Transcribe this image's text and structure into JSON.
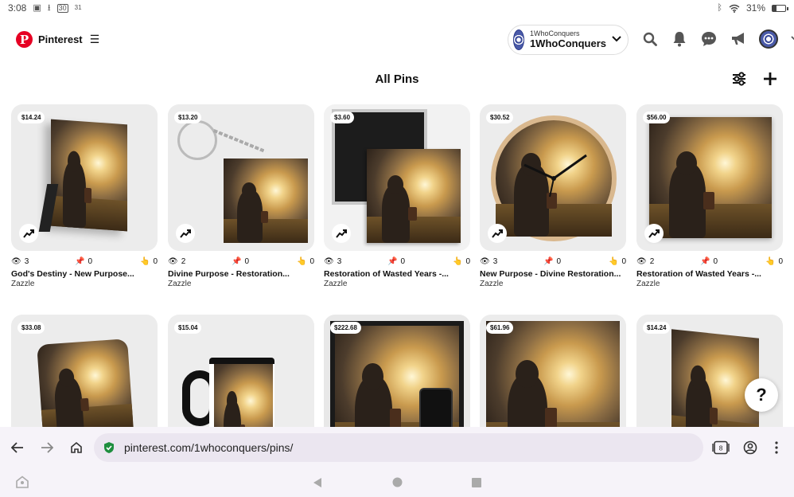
{
  "status_bar": {
    "time": "3:08",
    "notif_date": "30",
    "notif_extra": "31",
    "battery_text": "31%",
    "battery_level": 0.31
  },
  "header": {
    "brand": "Pinterest",
    "account_small": "1WhoConquers",
    "account_big": "1WhoConquers",
    "icons": [
      "search-icon",
      "bell-icon",
      "messages-icon",
      "megaphone-icon",
      "avatar",
      "chevron-down-icon"
    ]
  },
  "page": {
    "title": "All Pins"
  },
  "pins": [
    {
      "price": "$14.24",
      "views": "3",
      "saves": "0",
      "clicks": "0",
      "title": "God's Destiny - New Purpose...",
      "source": "Zazzle"
    },
    {
      "price": "$13.20",
      "views": "2",
      "saves": "0",
      "clicks": "0",
      "title": "Divine Purpose - Restoration...",
      "source": "Zazzle"
    },
    {
      "price": "$3.60",
      "views": "3",
      "saves": "0",
      "clicks": "0",
      "title": "Restoration of Wasted Years -...",
      "source": "Zazzle"
    },
    {
      "price": "$30.52",
      "views": "3",
      "saves": "0",
      "clicks": "0",
      "title": "New Purpose - Divine Restoration...",
      "source": "Zazzle"
    },
    {
      "price": "$56.00",
      "views": "2",
      "saves": "0",
      "clicks": "0",
      "title": "Restoration of Wasted Years -...",
      "source": "Zazzle"
    },
    {
      "price": "$33.08"
    },
    {
      "price": "$15.04"
    },
    {
      "price": "$222.68"
    },
    {
      "price": "$61.96"
    },
    {
      "price": "$14.24"
    }
  ],
  "help": {
    "label": "?"
  },
  "browser": {
    "url": "pinterest.com/1whoconquers/pins/",
    "tab_count": "8"
  },
  "colors": {
    "brand_red": "#e60023",
    "secure_green": "#1e8e3e"
  }
}
